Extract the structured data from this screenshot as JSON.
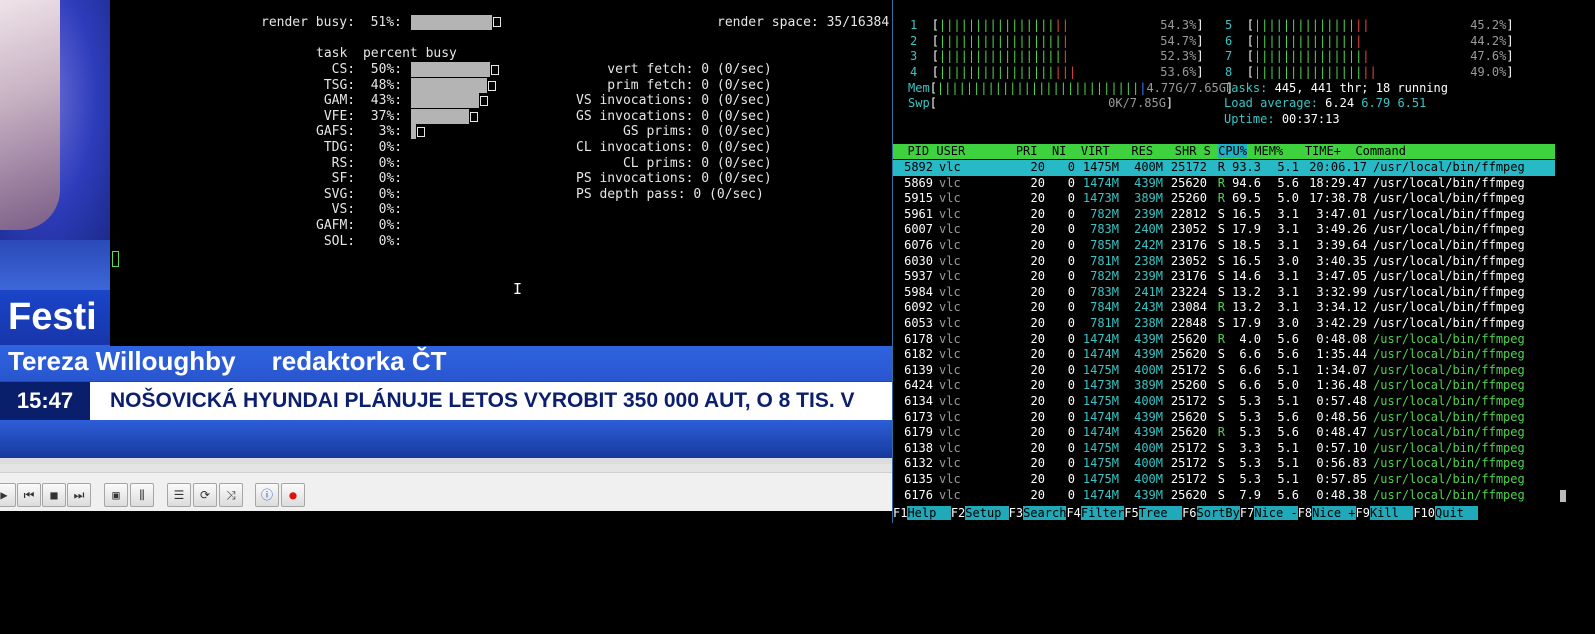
{
  "video": {
    "festival_text": "Festi",
    "name_text": "Tereza Willoughby     redaktorka ČT",
    "clock": "15:47",
    "ticker": "NOŠOVICKÁ HYUNDAI PLÁNUJE LETOS VYROBIT 350 000 AUT, O 8 TIS. V"
  },
  "gpu": {
    "render_busy_label": "render busy:  51%:",
    "render_busy_fraction": 0.51,
    "render_space": "render space: 35/16384",
    "task_header": "task  percent busy",
    "tasks": [
      {
        "label": "  CS:  50%:",
        "fraction": 0.5
      },
      {
        "label": " TSG:  48%:",
        "fraction": 0.48
      },
      {
        "label": " GAM:  43%:",
        "fraction": 0.43
      },
      {
        "label": " VFE:  37%:",
        "fraction": 0.37
      },
      {
        "label": "GAFS:   3%:",
        "fraction": 0.03
      },
      {
        "label": " TDG:   0%:",
        "fraction": 0.0
      },
      {
        "label": "  RS:   0%:",
        "fraction": 0.0
      },
      {
        "label": "  SF:   0%:",
        "fraction": 0.0
      },
      {
        "label": " SVG:   0%:",
        "fraction": 0.0
      },
      {
        "label": "  VS:   0%:",
        "fraction": 0.0
      },
      {
        "label": "GAFM:   0%:",
        "fraction": 0.0
      },
      {
        "label": " SOL:   0%:",
        "fraction": 0.0
      }
    ],
    "stats": [
      "    vert fetch: 0 (0/sec)",
      "    prim fetch: 0 (0/sec)",
      "VS invocations: 0 (0/sec)",
      "GS invocations: 0 (0/sec)",
      "      GS prims: 0 (0/sec)",
      "CL invocations: 0 (0/sec)",
      "      CL prims: 0 (0/sec)",
      "PS invocations: 0 (0/sec)",
      "PS depth pass: 0 (0/sec)"
    ]
  },
  "vlc": {
    "buttons": [
      "prev-icon",
      "stop-icon",
      "next-icon",
      "fullscreen-icon",
      "extended-settings-icon",
      "playlist-icon",
      "loop-icon",
      "shuffle-icon",
      "info-icon",
      "record-icon"
    ]
  },
  "htop": {
    "cpus": [
      {
        "id": "1",
        "green": "||||||||||||||||",
        "red": "||",
        "pct": "54.3%"
      },
      {
        "id": "2",
        "green": "|||||||||||||||||",
        "red": "|",
        "pct": "54.7%"
      },
      {
        "id": "3",
        "green": "|||||||||||||||||",
        "red": "|",
        "pct": "52.3%"
      },
      {
        "id": "4",
        "green": "||||||||||||||||",
        "red": "|||",
        "pct": "53.6%"
      },
      {
        "id": "5",
        "green": "||||||||||||||",
        "red": "||",
        "pct": "45.2%"
      },
      {
        "id": "6",
        "green": "||||||||||||||",
        "red": "|",
        "pct": "44.2%"
      },
      {
        "id": "7",
        "green": "|||||||||||||||",
        "red": "|",
        "pct": "47.6%"
      },
      {
        "id": "8",
        "green": "|||||||||||||||",
        "red": "||",
        "pct": "49.0%"
      }
    ],
    "mem_label": "Mem",
    "mem_bar": "||||||||||||||||||||||||||||",
    "mem_value": "4.77G/7.65G",
    "swp_label": "Swp",
    "swp_value": "0K/7.85G",
    "tasks_label": "Tasks:",
    "tasks_value": "445, 441 thr; 18 running",
    "load_label": "Load average:",
    "load_1": "6.24",
    "load_5": "6.79",
    "load_15": "6.51",
    "uptime_label": "Uptime:",
    "uptime_value": "00:37:13",
    "columns": "  PID USER       PRI  NI  VIRT   RES   SHR S ",
    "col_cpu": "CPU%",
    "col_rest": " MEM%   TIME+  Command",
    "processes": [
      {
        "pid": "5892",
        "user": "vlc",
        "pri": "20",
        "ni": "0",
        "virt": "1475M",
        "res": "400M",
        "shr": "25172",
        "s": "R",
        "cpu": "93.3",
        "mem": "5.1",
        "time": "20:06.17",
        "cmd": "/usr/local/bin/ffmpeg",
        "main": true
      },
      {
        "pid": "5869",
        "user": "vlc",
        "pri": "20",
        "ni": "0",
        "virt": "1474M",
        "res": "439M",
        "shr": "25620",
        "s": "R",
        "cpu": "94.6",
        "mem": "5.6",
        "time": "18:29.47",
        "cmd": "/usr/local/bin/ffmpeg",
        "main": true
      },
      {
        "pid": "5915",
        "user": "vlc",
        "pri": "20",
        "ni": "0",
        "virt": "1473M",
        "res": "389M",
        "shr": "25260",
        "s": "R",
        "cpu": "69.5",
        "mem": "5.0",
        "time": "17:38.78",
        "cmd": "/usr/local/bin/ffmpeg",
        "main": true
      },
      {
        "pid": "5961",
        "user": "vlc",
        "pri": "20",
        "ni": "0",
        "virt": "782M",
        "res": "239M",
        "shr": "22812",
        "s": "S",
        "cpu": "16.5",
        "mem": "3.1",
        "time": "3:47.01",
        "cmd": "/usr/local/bin/ffmpeg",
        "main": true
      },
      {
        "pid": "6007",
        "user": "vlc",
        "pri": "20",
        "ni": "0",
        "virt": "783M",
        "res": "240M",
        "shr": "23052",
        "s": "S",
        "cpu": "17.9",
        "mem": "3.1",
        "time": "3:49.26",
        "cmd": "/usr/local/bin/ffmpeg",
        "main": true
      },
      {
        "pid": "6076",
        "user": "vlc",
        "pri": "20",
        "ni": "0",
        "virt": "785M",
        "res": "242M",
        "shr": "23176",
        "s": "S",
        "cpu": "18.5",
        "mem": "3.1",
        "time": "3:39.64",
        "cmd": "/usr/local/bin/ffmpeg",
        "main": true
      },
      {
        "pid": "6030",
        "user": "vlc",
        "pri": "20",
        "ni": "0",
        "virt": "781M",
        "res": "238M",
        "shr": "23052",
        "s": "S",
        "cpu": "16.5",
        "mem": "3.0",
        "time": "3:40.35",
        "cmd": "/usr/local/bin/ffmpeg",
        "main": true
      },
      {
        "pid": "5937",
        "user": "vlc",
        "pri": "20",
        "ni": "0",
        "virt": "782M",
        "res": "239M",
        "shr": "23176",
        "s": "S",
        "cpu": "14.6",
        "mem": "3.1",
        "time": "3:47.05",
        "cmd": "/usr/local/bin/ffmpeg",
        "main": true
      },
      {
        "pid": "5984",
        "user": "vlc",
        "pri": "20",
        "ni": "0",
        "virt": "783M",
        "res": "241M",
        "shr": "23224",
        "s": "S",
        "cpu": "13.2",
        "mem": "3.1",
        "time": "3:32.99",
        "cmd": "/usr/local/bin/ffmpeg",
        "main": true
      },
      {
        "pid": "6092",
        "user": "vlc",
        "pri": "20",
        "ni": "0",
        "virt": "784M",
        "res": "243M",
        "shr": "23084",
        "s": "R",
        "cpu": "13.2",
        "mem": "3.1",
        "time": "3:34.12",
        "cmd": "/usr/local/bin/ffmpeg",
        "main": true
      },
      {
        "pid": "6053",
        "user": "vlc",
        "pri": "20",
        "ni": "0",
        "virt": "781M",
        "res": "238M",
        "shr": "22848",
        "s": "S",
        "cpu": "17.9",
        "mem": "3.0",
        "time": "3:42.29",
        "cmd": "/usr/local/bin/ffmpeg",
        "main": true
      },
      {
        "pid": "6178",
        "user": "vlc",
        "pri": "20",
        "ni": "0",
        "virt": "1474M",
        "res": "439M",
        "shr": "25620",
        "s": "R",
        "cpu": "4.0",
        "mem": "5.6",
        "time": "0:48.08",
        "cmd": "/usr/local/bin/ffmpeg",
        "main": false
      },
      {
        "pid": "6182",
        "user": "vlc",
        "pri": "20",
        "ni": "0",
        "virt": "1474M",
        "res": "439M",
        "shr": "25620",
        "s": "S",
        "cpu": "6.6",
        "mem": "5.6",
        "time": "1:35.44",
        "cmd": "/usr/local/bin/ffmpeg",
        "main": false
      },
      {
        "pid": "6139",
        "user": "vlc",
        "pri": "20",
        "ni": "0",
        "virt": "1475M",
        "res": "400M",
        "shr": "25172",
        "s": "S",
        "cpu": "6.6",
        "mem": "5.1",
        "time": "1:34.07",
        "cmd": "/usr/local/bin/ffmpeg",
        "main": false
      },
      {
        "pid": "6424",
        "user": "vlc",
        "pri": "20",
        "ni": "0",
        "virt": "1473M",
        "res": "389M",
        "shr": "25260",
        "s": "S",
        "cpu": "6.6",
        "mem": "5.0",
        "time": "1:36.48",
        "cmd": "/usr/local/bin/ffmpeg",
        "main": false
      },
      {
        "pid": "6134",
        "user": "vlc",
        "pri": "20",
        "ni": "0",
        "virt": "1475M",
        "res": "400M",
        "shr": "25172",
        "s": "S",
        "cpu": "5.3",
        "mem": "5.1",
        "time": "0:57.48",
        "cmd": "/usr/local/bin/ffmpeg",
        "main": false
      },
      {
        "pid": "6173",
        "user": "vlc",
        "pri": "20",
        "ni": "0",
        "virt": "1474M",
        "res": "439M",
        "shr": "25620",
        "s": "S",
        "cpu": "5.3",
        "mem": "5.6",
        "time": "0:48.56",
        "cmd": "/usr/local/bin/ffmpeg",
        "main": false
      },
      {
        "pid": "6179",
        "user": "vlc",
        "pri": "20",
        "ni": "0",
        "virt": "1474M",
        "res": "439M",
        "shr": "25620",
        "s": "R",
        "cpu": "5.3",
        "mem": "5.6",
        "time": "0:48.47",
        "cmd": "/usr/local/bin/ffmpeg",
        "main": false
      },
      {
        "pid": "6138",
        "user": "vlc",
        "pri": "20",
        "ni": "0",
        "virt": "1475M",
        "res": "400M",
        "shr": "25172",
        "s": "S",
        "cpu": "3.3",
        "mem": "5.1",
        "time": "0:57.10",
        "cmd": "/usr/local/bin/ffmpeg",
        "main": false
      },
      {
        "pid": "6132",
        "user": "vlc",
        "pri": "20",
        "ni": "0",
        "virt": "1475M",
        "res": "400M",
        "shr": "25172",
        "s": "S",
        "cpu": "5.3",
        "mem": "5.1",
        "time": "0:56.83",
        "cmd": "/usr/local/bin/ffmpeg",
        "main": false
      },
      {
        "pid": "6135",
        "user": "vlc",
        "pri": "20",
        "ni": "0",
        "virt": "1475M",
        "res": "400M",
        "shr": "25172",
        "s": "S",
        "cpu": "5.3",
        "mem": "5.1",
        "time": "0:57.85",
        "cmd": "/usr/local/bin/ffmpeg",
        "main": false
      },
      {
        "pid": "6176",
        "user": "vlc",
        "pri": "20",
        "ni": "0",
        "virt": "1474M",
        "res": "439M",
        "shr": "25620",
        "s": "S",
        "cpu": "7.9",
        "mem": "5.6",
        "time": "0:48.38",
        "cmd": "/usr/local/bin/ffmpeg",
        "main": false
      }
    ],
    "fkeys": [
      {
        "k": "F1",
        "l": "Help  "
      },
      {
        "k": "F2",
        "l": "Setup "
      },
      {
        "k": "F3",
        "l": "Search"
      },
      {
        "k": "F4",
        "l": "Filter"
      },
      {
        "k": "F5",
        "l": "Tree  "
      },
      {
        "k": "F6",
        "l": "SortBy"
      },
      {
        "k": "F7",
        "l": "Nice -"
      },
      {
        "k": "F8",
        "l": "Nice +"
      },
      {
        "k": "F9",
        "l": "Kill  "
      },
      {
        "k": "F10",
        "l": "Quit  "
      }
    ]
  }
}
